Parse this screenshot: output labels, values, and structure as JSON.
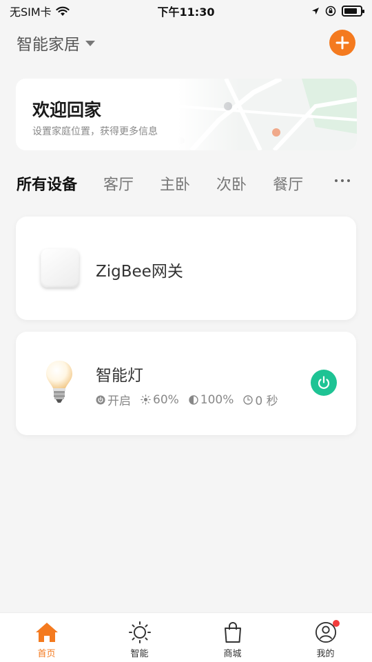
{
  "status_bar": {
    "carrier": "无SIM卡",
    "time": "下午11:30"
  },
  "header": {
    "home_name": "智能家居"
  },
  "welcome": {
    "title": "欢迎回家",
    "subtitle": "设置家庭位置，获得更多信息"
  },
  "room_tabs": [
    "所有设备",
    "客厅",
    "主卧",
    "次卧",
    "餐厅"
  ],
  "devices": [
    {
      "name": "ZigBee网关",
      "icon": "gateway-icon"
    },
    {
      "name": "智能灯",
      "icon": "light-bulb-icon",
      "power": "开启",
      "brightness": "60%",
      "color_temp": "100%",
      "timer": "0 秒",
      "power_button_color": "#1ec394"
    }
  ],
  "bottom_nav": [
    {
      "label": "首页",
      "icon": "home-icon",
      "active": true
    },
    {
      "label": "智能",
      "icon": "sun-icon",
      "active": false
    },
    {
      "label": "商城",
      "icon": "shopping-bag-icon",
      "active": false
    },
    {
      "label": "我的",
      "icon": "user-icon",
      "active": false
    }
  ],
  "colors": {
    "accent": "#f47a1f",
    "power_on": "#1ec394",
    "notification": "#f23c3c"
  }
}
